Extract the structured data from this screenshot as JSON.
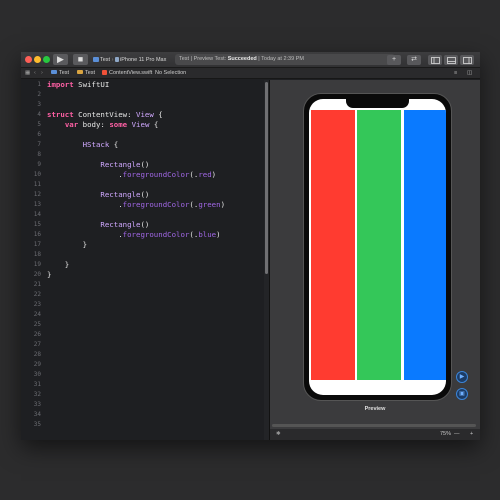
{
  "toolbar": {
    "scheme_project": "Test",
    "scheme_device": "iPhone 11 Pro Max",
    "status_prefix": "Test | Preview Test: ",
    "status_result": "Succeeded",
    "status_suffix": " | Today at 2:39 PM",
    "add_label": "+",
    "swap_label": "⇄",
    "run_icon": "play-icon",
    "stop_icon": "stop-icon"
  },
  "jumpbar": {
    "items": [
      "Test",
      "Test",
      "ContentView.swift",
      "No Selection"
    ]
  },
  "editor": {
    "line_numbers": [
      "1",
      "2",
      "3",
      "4",
      "5",
      "6",
      "7",
      "8",
      "9",
      "10",
      "11",
      "12",
      "13",
      "14",
      "15",
      "16",
      "17",
      "18",
      "19",
      "20",
      "21",
      "22",
      "23",
      "24",
      "25",
      "26",
      "27",
      "28",
      "29",
      "30",
      "31",
      "32",
      "33",
      "34",
      "35"
    ],
    "lines": [
      "import SwiftUI",
      "",
      "",
      "struct ContentView: View {",
      "    var body: some View {",
      "",
      "        HStack {",
      "",
      "            Rectangle()",
      "                .foregroundColor(.red)",
      "",
      "            Rectangle()",
      "                .foregroundColor(.green)",
      "",
      "            Rectangle()",
      "                .foregroundColor(.blue)",
      "        }",
      "",
      "    }",
      "}"
    ]
  },
  "canvas": {
    "preview_label": "Preview",
    "zoom": "75%",
    "zoom_out": "—",
    "zoom_in": "+",
    "colors": {
      "red": "#ff3b30",
      "green": "#34c759",
      "blue": "#0a7aff"
    }
  },
  "theme": {
    "accent": "#3a84d8"
  }
}
